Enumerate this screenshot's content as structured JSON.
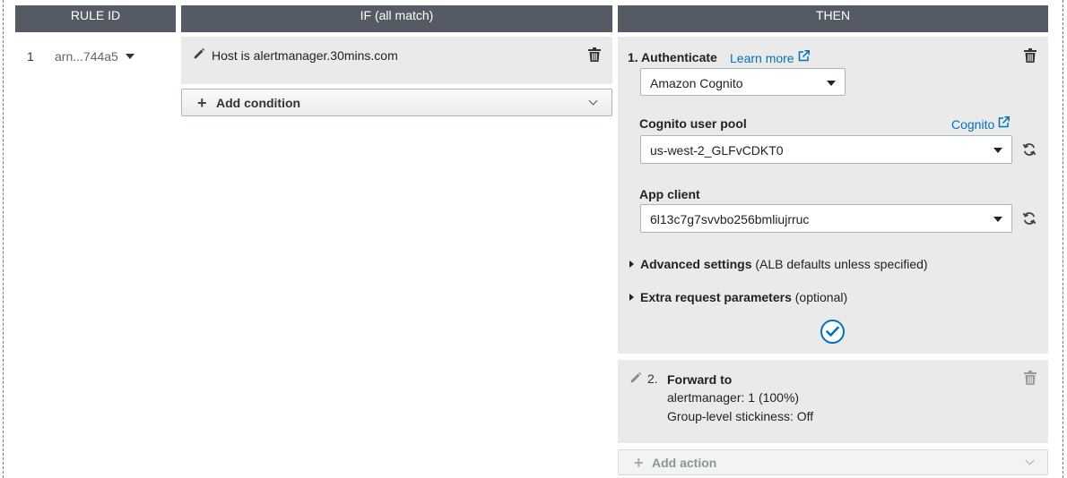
{
  "headers": {
    "rule_id": "RULE ID",
    "if": "IF (all match)",
    "then": "THEN"
  },
  "rule": {
    "number": "1",
    "arn": "arn...744a5"
  },
  "condition": {
    "text": "Host is alertmanager.30mins.com",
    "add_label": "Add condition"
  },
  "authenticate": {
    "title": "1. Authenticate",
    "learn_more": "Learn more",
    "provider": "Amazon Cognito",
    "user_pool_label": "Cognito user pool",
    "cognito_link": "Cognito",
    "user_pool_value": "us-west-2_GLFvCDKT0",
    "app_client_label": "App client",
    "app_client_value": "6l13c7g7svvbo256bmliujrruc",
    "advanced_label": "Advanced settings",
    "advanced_note": "(ALB defaults unless specified)",
    "extra_label": "Extra request parameters",
    "extra_note": "(optional)"
  },
  "forward": {
    "number": "2.",
    "title": "Forward to",
    "target": "alertmanager: 1 (100%)",
    "stickiness": "Group-level stickiness: Off"
  },
  "add_action_label": "Add action",
  "icons": [
    "pencil-icon",
    "trash-icon",
    "external-link-icon",
    "refresh-icon",
    "check-icon",
    "plus-icon",
    "chevron-down-icon",
    "caret-down-icon"
  ],
  "colors": {
    "header_bg": "#545b64",
    "panel_bg": "#eaeaea",
    "link": "#0073bb"
  }
}
